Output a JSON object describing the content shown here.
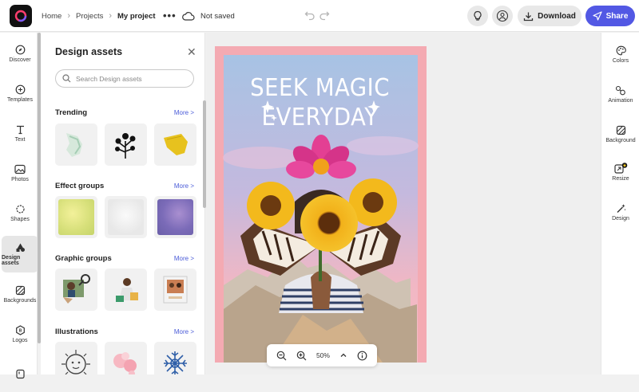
{
  "topbar": {
    "breadcrumbs": [
      "Home",
      "Projects",
      "My project"
    ],
    "save_status": "Not saved",
    "download_label": "Download",
    "share_label": "Share"
  },
  "left_nav": {
    "items": [
      {
        "label": "Discover",
        "icon": "compass-icon"
      },
      {
        "label": "Templates",
        "icon": "templates-icon"
      },
      {
        "label": "Text",
        "icon": "text-icon"
      },
      {
        "label": "Photos",
        "icon": "photo-icon"
      },
      {
        "label": "Shapes",
        "icon": "shapes-icon"
      },
      {
        "label": "Design assets",
        "icon": "design-assets-icon",
        "active": true
      },
      {
        "label": "Backgrounds",
        "icon": "backgrounds-icon"
      },
      {
        "label": "Logos",
        "icon": "logo-icon"
      }
    ]
  },
  "panel": {
    "title": "Design assets",
    "search_placeholder": "Search Design assets",
    "sections": [
      {
        "title": "Trending",
        "more": "More >"
      },
      {
        "title": "Effect groups",
        "more": "More >"
      },
      {
        "title": "Graphic groups",
        "more": "More >"
      },
      {
        "title": "Illustrations",
        "more": "More >"
      }
    ]
  },
  "canvas": {
    "headline_line1": "SEEK MAGIC",
    "headline_line2": "EVERYDAY",
    "zoom": "50%"
  },
  "right_nav": {
    "items": [
      {
        "label": "Colors",
        "icon": "palette-icon"
      },
      {
        "label": "Animation",
        "icon": "animation-icon"
      },
      {
        "label": "Background",
        "icon": "background-icon"
      },
      {
        "label": "Resize",
        "icon": "resize-icon"
      },
      {
        "label": "Design",
        "icon": "magic-wand-icon"
      }
    ]
  },
  "colors": {
    "accent": "#5258e4",
    "link": "#4a5bd8",
    "poster_border": "#f4aab2"
  }
}
